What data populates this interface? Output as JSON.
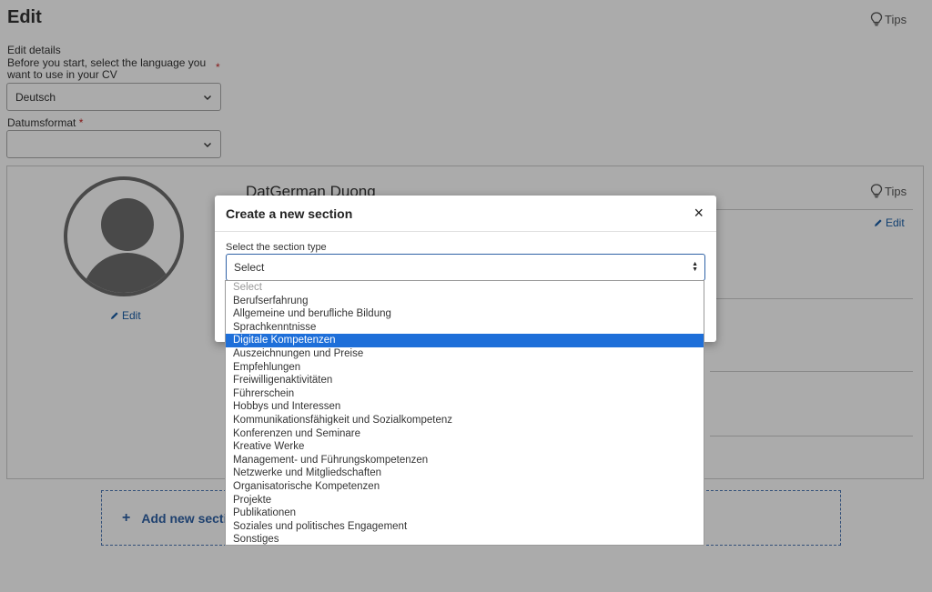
{
  "page": {
    "title": "Edit",
    "tips_label": "Tips",
    "edit_details": "Edit details",
    "language_label": "Before you start, select the language you want to use in your CV",
    "language_value": "Deutsch",
    "date_format_label": "Datumsformat",
    "date_format_value": "",
    "required_marker": "*"
  },
  "profile": {
    "name": "DatGerman Duong",
    "tips_label": "Tips",
    "edit_label": "Edit",
    "avatar_edit_label": "Edit"
  },
  "add_section": {
    "plus": "+",
    "label": "Add new section"
  },
  "modal": {
    "title": "Create a new section",
    "close": "×",
    "select_label": "Select the section type",
    "select_value": "Select",
    "options": [
      "Select",
      "Berufserfahrung",
      "Allgemeine und berufliche Bildung",
      "Sprachkenntnisse",
      "Digitale Kompetenzen",
      "Auszeichnungen und Preise",
      "Empfehlungen",
      "Freiwilligenaktivitäten",
      "Führerschein",
      "Hobbys und Interessen",
      "Kommunikationsfähigkeit und Sozialkompetenz",
      "Konferenzen und Seminare",
      "Kreative Werke",
      "Management- und Führungskompetenzen",
      "Netzwerke und Mitgliedschaften",
      "Organisatorische Kompetenzen",
      "Projekte",
      "Publikationen",
      "Soziales und politisches Engagement",
      "Sonstiges"
    ],
    "highlighted_option": "Digitale Kompetenzen"
  },
  "colors": {
    "accent": "#1e6fd9",
    "link": "#1a5fa8",
    "required": "#c62828"
  }
}
